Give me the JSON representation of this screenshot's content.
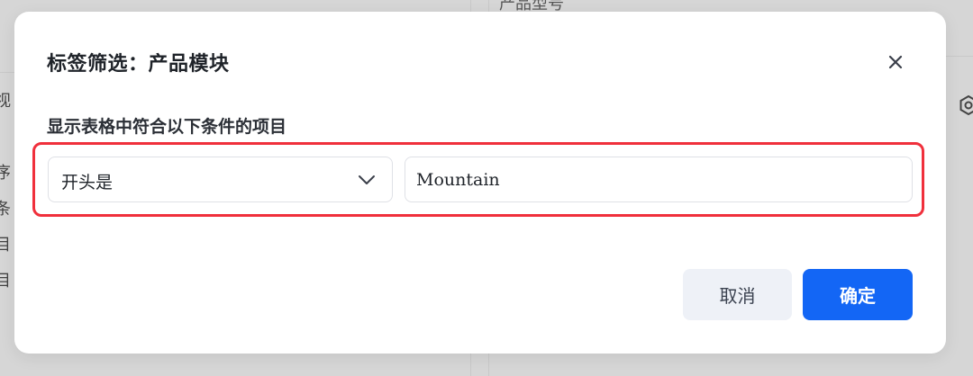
{
  "background": {
    "top_text": "产品型号",
    "left_chars": [
      "视",
      "序",
      "条",
      "目",
      "目"
    ]
  },
  "dialog": {
    "title": "标签筛选：产品模块",
    "description": "显示表格中符合以下条件的项目",
    "condition": {
      "selected": "开头是",
      "icon": "chevron-down-icon"
    },
    "value_input": {
      "value": "Mountain",
      "placeholder": ""
    },
    "close_icon": "close-icon",
    "buttons": {
      "cancel": "取消",
      "confirm": "确定"
    }
  },
  "colors": {
    "primary": "#1366f5",
    "highlight": "#f0303c",
    "cancel_bg": "#eef1f7"
  }
}
